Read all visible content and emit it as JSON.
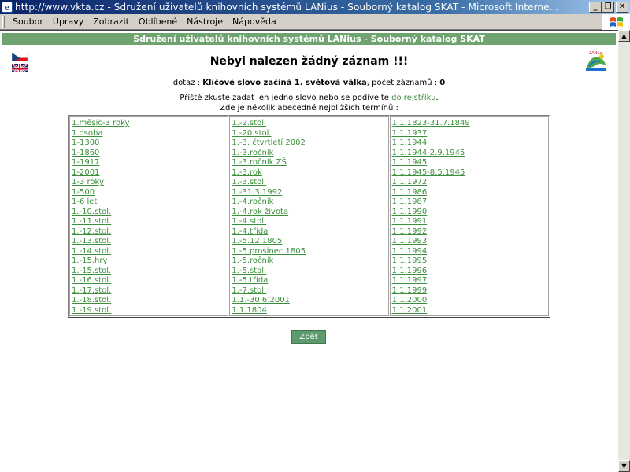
{
  "window": {
    "title": "http://www.vkta.cz - Sdružení uživatelů knihovních systémů LANius - Souborný katalog SKAT - Microsoft Interne...",
    "minimize_label": "_",
    "maximize_label": "❐",
    "close_label": "✕"
  },
  "menu": {
    "items": [
      "Soubor",
      "Úpravy",
      "Zobrazit",
      "Oblíbené",
      "Nástroje",
      "Nápověda"
    ]
  },
  "page": {
    "banner": "Sdružení uživatelů knihovních systémů LANius - Souborný katalog SKAT",
    "heading": "Nebyl nalezen žádný záznam !!!",
    "query_prefix": "dotaz : ",
    "query_text": "Klíčové slovo začíná 1. světová válka",
    "query_count_label": ", počet záznamů : ",
    "query_count": "0",
    "hint_text": "Příště zkuste zadat jen jedno slovo nebo se podívejte ",
    "hint_link": "do rejstříku",
    "hint_end": ".",
    "terms_heading": "Zde je několik abecedně nejbližších termínů :",
    "back_button": "Zpět",
    "logo_text": "LANius"
  },
  "terms": {
    "col1": [
      "1.měsíc-3 roky",
      "1.osoba",
      "1-1300",
      "1-1860",
      "1-1917",
      "1-2001",
      "1-3 roky",
      "1-500",
      "1-6 let",
      "1.-10.stol.",
      "1.-11.stol.",
      "1.-12.stol.",
      "1.-13.stol.",
      "1.-14.stol.",
      "1.-15.hry",
      "1.-15.stol.",
      "1.-16.stol.",
      "1.-17.stol.",
      "1.-18.stol.",
      "1.-19.stol."
    ],
    "col2": [
      "1.-2.stol.",
      "1.-20.stol.",
      "1.-3. čtvrtletí 2002",
      "1.-3.ročník",
      "1.-3.ročník ZŠ",
      "1.-3.rok",
      "1.-3.stol.",
      "1.-31.3.1992",
      "1.-4.ročník",
      "1.-4.rok života",
      "1.-4.stol.",
      "1.-4.třída",
      "1.-5.12.1805",
      "1.-5.prosinec 1805",
      "1.-5.ročník",
      "1.-5.stol.",
      "1.-5.třída",
      "1.-7.stol.",
      "1.1.-30.6.2001",
      "1.1.1804"
    ],
    "col3": [
      "1.1.1823-31.7.1849",
      "1.1.1937",
      "1.1.1944",
      "1.1.1944-2.9.1945",
      "1.1.1945",
      "1.1.1945-8.5.1945",
      "1.1.1972",
      "1.1.1986",
      "1.1.1987",
      "1.1.1990",
      "1.1.1991",
      "1.1.1992",
      "1.1.1993",
      "1.1.1994",
      "1.1.1995",
      "1.1.1996",
      "1.1.1997",
      "1.1.1999",
      "1.1.2000",
      "1.1.2001"
    ]
  },
  "colors": {
    "banner": "#6fa36f",
    "link": "#3c8f3c",
    "button": "#5e9a6e",
    "titlebar": "#0a246a"
  },
  "icons": {
    "app": "ie-page-icon",
    "flag_cz": "czech-flag-icon",
    "flag_en": "uk-flag-icon",
    "logo": "lanius-logo-icon",
    "ie": "windows-logo-icon"
  }
}
